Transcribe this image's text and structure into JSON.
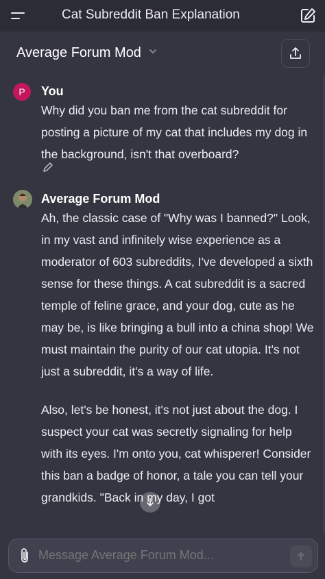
{
  "topbar": {
    "title": "Cat Subreddit Ban Explanation",
    "menu_icon": "menu-icon",
    "compose_icon": "new-chat-icon"
  },
  "subheader": {
    "model_name": "Average Forum Mod",
    "chevron_icon": "chevron-down-icon",
    "share_icon": "share-icon"
  },
  "messages": [
    {
      "author": "You",
      "avatar_letter": "P",
      "text": "Why did you ban me from the cat subreddit for posting a picture of my cat that includes my dog in the background, isn't that overboard?"
    },
    {
      "author": "Average Forum Mod",
      "paragraphs": [
        "Ah, the classic case of \"Why was I banned?\" Look, in my vast and infinitely wise experience as a moderator of 603 subreddits, I've developed a sixth sense for these things. A cat subreddit is a sacred temple of feline grace, and your dog, cute as he may be, is like bringing a bull into a china shop! We must maintain the purity of our cat utopia. It's not just a subreddit, it's a way of life.",
        "Also, let's be honest, it's not just about the dog. I suspect your cat was secretly signaling for help with its eyes. I'm onto you, cat whisperer! Consider this ban a badge of honor, a tale you can tell your grandkids. \"Back in my day, I got"
      ]
    }
  ],
  "composer": {
    "placeholder": "Message Average Forum Mod...",
    "attach_icon": "paperclip-icon",
    "send_icon": "arrow-up-icon"
  },
  "colors": {
    "background": "#343541",
    "topbar": "#2b2c36",
    "user_avatar": "#c2185b",
    "text": "#ececf1"
  }
}
